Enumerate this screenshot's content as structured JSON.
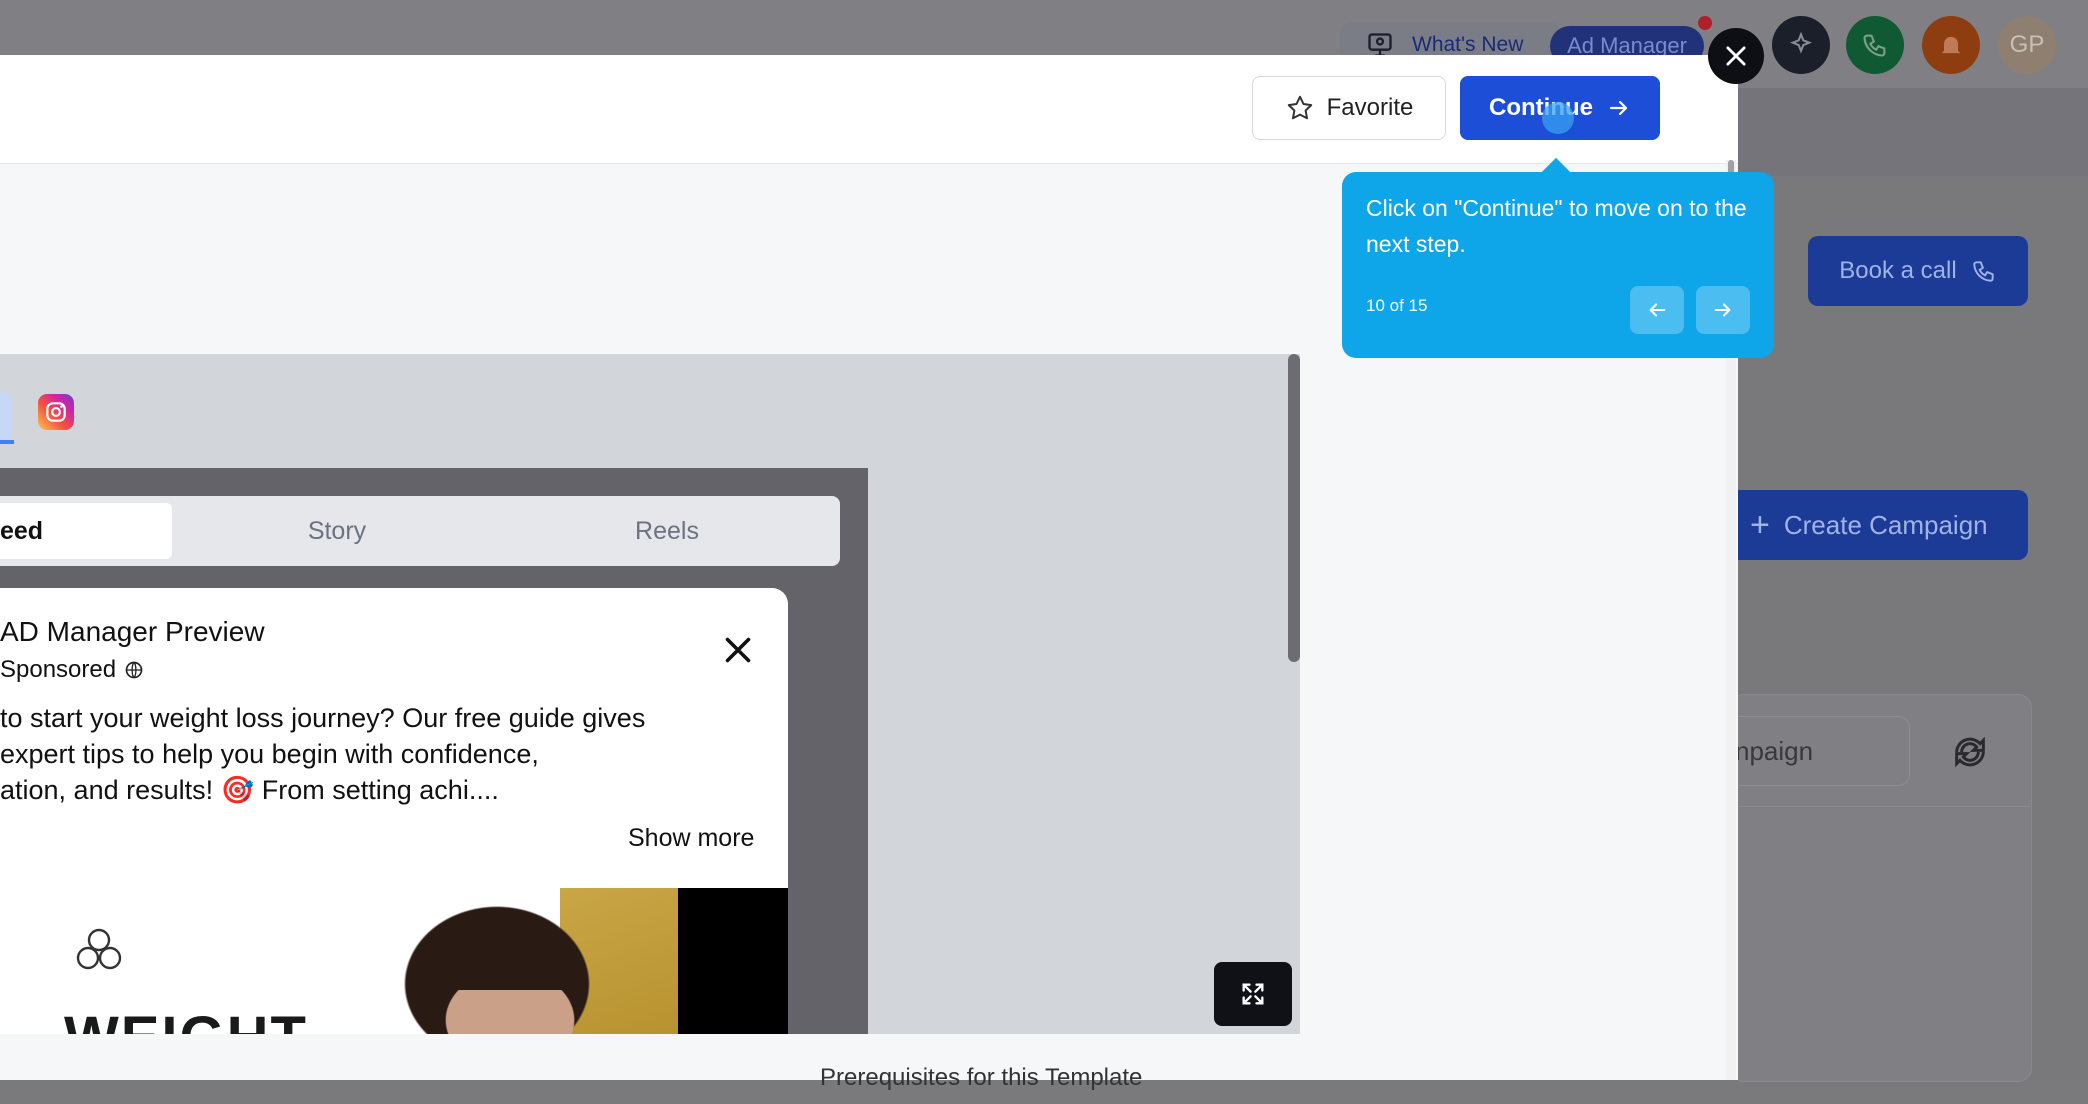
{
  "background_app": {
    "whats_new": "What's New",
    "ad_manager": "Ad Manager",
    "avatar_initials": "GP",
    "book_call": "Book a call",
    "create_campaign": "Create Campaign",
    "search_partial": "npaign"
  },
  "modal": {
    "favorite_label": "Favorite",
    "continue_label": "Continue",
    "tabs": [
      "eed",
      "Story",
      "Reels"
    ],
    "post": {
      "title": "AD Manager Preview",
      "sponsored": "Sponsored",
      "body_lines": [
        "to start your weight loss journey? Our free guide gives",
        "expert tips to help you begin with confidence,",
        "ation, and results! 🎯 From setting achi...."
      ],
      "show_more": "Show more",
      "image_text": "WEIGHT"
    },
    "bottom_text": "Prerequisites for this Template"
  },
  "tooltip": {
    "text": "Click on \"Continue\" to move on to the next step.",
    "step": "10 of 15"
  },
  "colors": {
    "primary": "#1d4ed8",
    "tooltip": "#0ea5e9"
  }
}
